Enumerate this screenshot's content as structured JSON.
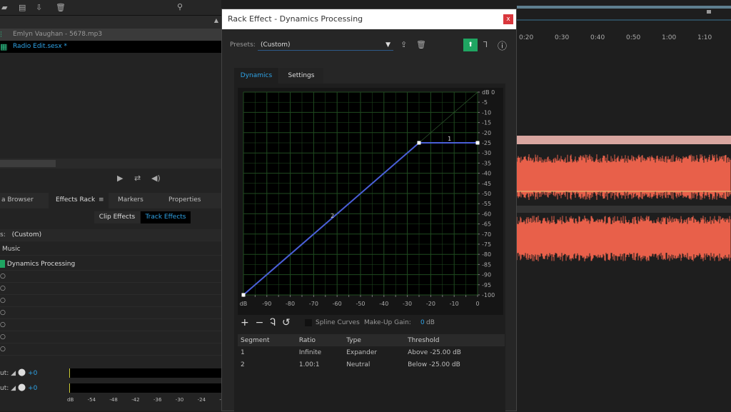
{
  "files": {
    "items": [
      "Emlyn Vaughan - 5678.mp3",
      "Radio Edit.sesx *"
    ]
  },
  "panel_tabs": [
    "a Browser",
    "Effects Rack",
    "Markers",
    "Properties"
  ],
  "effect_toggle": {
    "clip": "Clip Effects",
    "track": "Track Effects"
  },
  "rack": {
    "preset_label": "s:",
    "preset": "(Custom)",
    "track": "Music",
    "effect": "Dynamics Processing",
    "input_label": "ut:",
    "input_val": "+0",
    "output_label": "ut:",
    "output_val": "+0",
    "meter_ticks": [
      "dB",
      "-54",
      "-48",
      "-42",
      "-36",
      "-30",
      "-24",
      "-"
    ]
  },
  "timeline": {
    "ticks": [
      "0:20",
      "0:30",
      "0:40",
      "0:50",
      "1:00",
      "1:10"
    ]
  },
  "dialog": {
    "title": "Rack Effect - Dynamics Processing",
    "close": "x",
    "presets_label": "Presets:",
    "preset": "(Custom)",
    "tabs": [
      "Dynamics",
      "Settings"
    ],
    "spline": "Spline Curves",
    "makeup_label": "Make-Up Gain:",
    "makeup_val": "0",
    "makeup_unit": "dB",
    "table": {
      "headers": [
        "Segment",
        "Ratio",
        "Type",
        "Threshold"
      ],
      "rows": [
        [
          "1",
          "Infinite",
          "Expander",
          "Above -25.00 dB"
        ],
        [
          "2",
          "1.00:1",
          "Neutral",
          "Below -25.00 dB"
        ]
      ]
    }
  },
  "chart_data": {
    "type": "line",
    "xlabel": "dB",
    "ylabel": "dB",
    "xlim": [
      -100,
      0
    ],
    "ylim": [
      -100,
      0
    ],
    "x_ticks": [
      "dB",
      "-90",
      "-80",
      "-70",
      "-60",
      "-50",
      "-40",
      "-30",
      "-20",
      "-10",
      "0"
    ],
    "y_ticks": [
      "dB 0",
      "-5",
      "-10",
      "-15",
      "-20",
      "-25",
      "-30",
      "-35",
      "-40",
      "-45",
      "-50",
      "-55",
      "-60",
      "-65",
      "-70",
      "-75",
      "-80",
      "-85",
      "-90",
      "-95",
      "-100"
    ],
    "points": [
      [
        -100,
        -100
      ],
      [
        -25,
        -25
      ],
      [
        0,
        -25
      ]
    ],
    "segment_labels": [
      {
        "label": "1",
        "x": -12,
        "y": -24
      },
      {
        "label": "2",
        "x": -62,
        "y": -62
      }
    ],
    "grid": true,
    "line_color": "#4a5fd8",
    "grid_color": "#1f4a1f"
  },
  "colors": {
    "accent": "#2fa3e6",
    "waveform": "#e8604a",
    "green": "#1fa562"
  }
}
